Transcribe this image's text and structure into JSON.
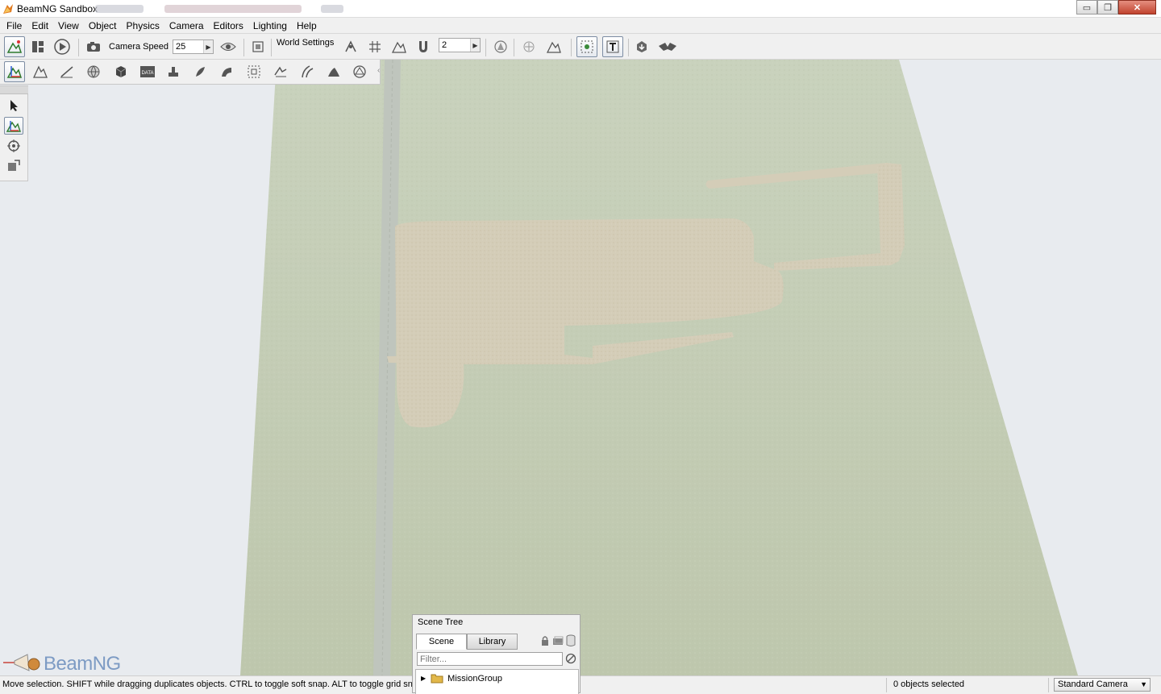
{
  "window": {
    "title": "BeamNG Sandbox",
    "minimize_glyph": "▭",
    "restore_glyph": "❐",
    "close_glyph": "✕"
  },
  "menu": [
    "File",
    "Edit",
    "View",
    "Object",
    "Physics",
    "Camera",
    "Editors",
    "Lighting",
    "Help"
  ],
  "toolbar": {
    "camera_speed_label": "Camera Speed",
    "camera_speed_value": "25",
    "world_settings_label": "World Settings",
    "snap_value": "2",
    "icons": [
      "world-editor-icon",
      "layout-icon",
      "play-icon",
      "camera-icon",
      "eye-icon",
      "frame-icon",
      "snap-settings-icon",
      "grid-icon",
      "terrain-snap-icon",
      "magnet-icon",
      "bounds-icon",
      "center-icon",
      "object-snap-icon",
      "select-mode-icon",
      "text-mode-icon",
      "drop-icon",
      "fly-icon"
    ]
  },
  "editor_toolbar": {
    "icons": [
      "object-editor-icon",
      "terrain-editor-icon",
      "terrain-painter-icon",
      "material-editor-icon",
      "sketch-tool-icon",
      "datablock-editor-icon",
      "decal-editor-icon",
      "forest-editor-icon",
      "mesh-road-editor-icon",
      "convex-editor-icon",
      "river-editor-icon",
      "road-editor-icon",
      "decal-road-editor-icon",
      "navmesh-editor-icon"
    ]
  },
  "palette": {
    "tools": [
      "select-arrow-icon",
      "move-tool-icon",
      "rotate-tool-icon",
      "scale-tool-icon"
    ]
  },
  "logo": {
    "text": "BeamNG"
  },
  "scene_tree": {
    "title": "Scene Tree",
    "tabs": [
      "Scene",
      "Library"
    ],
    "filter_placeholder": "Filter...",
    "items": [
      {
        "label": "MissionGroup",
        "expanded": false
      }
    ]
  },
  "status": {
    "message": "Move selection.  SHIFT while dragging duplicates objects.  CTRL to toggle soft snap.  ALT to toggle grid snap.",
    "selection_count": "0 objects selected",
    "camera_mode": "Standard Camera"
  },
  "colors": {
    "grass": "#c3ccb4",
    "dirt": "#d4cdb7",
    "road": "#bfc4bd",
    "sky": "#e8ebef",
    "accent": "#7d9bc4"
  }
}
